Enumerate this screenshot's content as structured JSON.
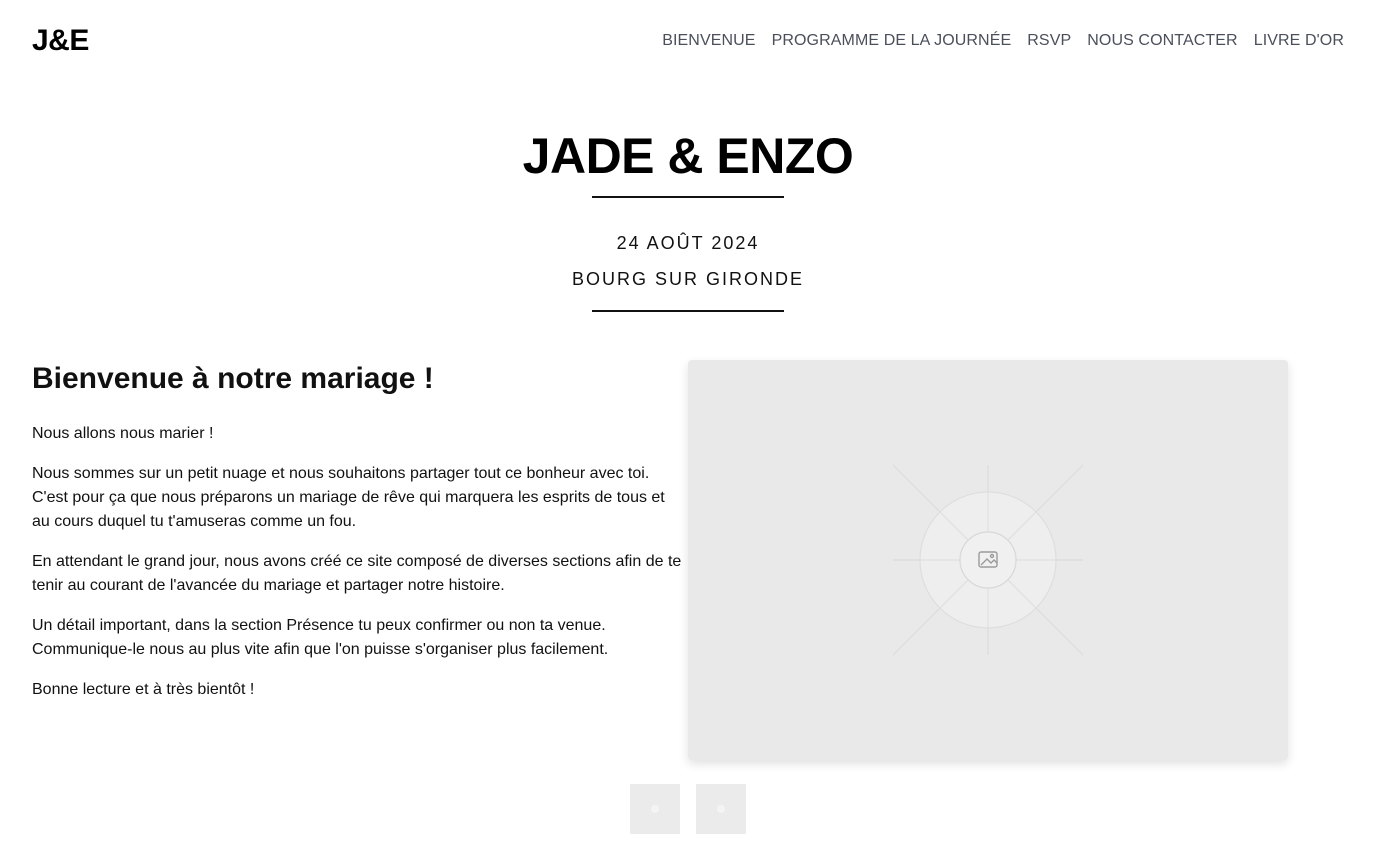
{
  "header": {
    "logo": "J&E",
    "nav": [
      {
        "label": "BIENVENUE"
      },
      {
        "label": "PROGRAMME DE LA JOURNÉE"
      },
      {
        "label": "RSVP"
      },
      {
        "label": "NOUS CONTACTER"
      },
      {
        "label": "LIVRE D'OR"
      }
    ]
  },
  "hero": {
    "title": "JADE & ENZO",
    "date": "24 AOÛT 2024",
    "place": "BOURG SUR GIRONDE"
  },
  "welcome": {
    "heading": "Bienvenue à notre mariage !",
    "paragraphs": [
      "Nous allons nous marier !",
      "Nous sommes sur un petit nuage et nous souhaitons partager tout ce bonheur avec toi. C'est pour ça que nous préparons un mariage de rêve qui marquera les esprits de tous et au cours duquel tu t'amuseras comme un fou.",
      "En attendant le grand jour, nous avons créé ce site composé de diverses sections afin de te tenir au courant de l'avancée du mariage et partager notre histoire.",
      "Un détail important, dans la section Présence tu peux confirmer ou non ta venue. Communique-le nous au plus vite afin que l'on puisse s'organiser plus facilement.",
      "Bonne lecture et à très bientôt !"
    ]
  },
  "gallery": {
    "main_image_icon": "image-placeholder-icon",
    "thumbnails": 2
  },
  "colors": {
    "text": "#111111",
    "nav_text": "#4a4f5a",
    "placeholder_bg": "#e9e9e9"
  }
}
